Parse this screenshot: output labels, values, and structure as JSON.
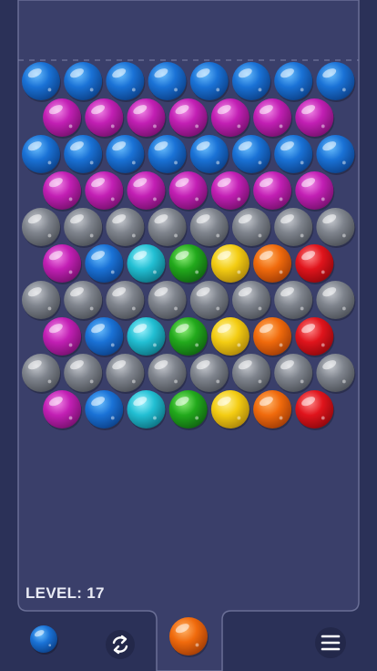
{
  "colors": {
    "background": "#2b3158",
    "board": "#3a3f6a",
    "board_edge": "#6a6f96",
    "text": "#e9ebf5"
  },
  "bubble_palette": {
    "B": {
      "name": "blue",
      "light": "#6cc0ff",
      "base": "#1a72d6",
      "dark": "#0b3f86"
    },
    "M": {
      "name": "magenta",
      "light": "#f28be8",
      "base": "#c21fb4",
      "dark": "#74106b"
    },
    "G": {
      "name": "gray",
      "light": "#c6c9cf",
      "base": "#7f848d",
      "dark": "#4a4e55"
    },
    "C": {
      "name": "cyan",
      "light": "#9ff4ff",
      "base": "#22bfd3",
      "dark": "#0c6f7e"
    },
    "N": {
      "name": "green",
      "light": "#8ff079",
      "base": "#22a91c",
      "dark": "#0f6010"
    },
    "Y": {
      "name": "yellow",
      "light": "#fff49a",
      "base": "#f3cc12",
      "dark": "#a8820a"
    },
    "O": {
      "name": "orange",
      "light": "#ffb56b",
      "base": "#f06a0c",
      "dark": "#9d3a06"
    },
    "R": {
      "name": "red",
      "light": "#ff8a8a",
      "base": "#e0141c",
      "dark": "#8c070c"
    }
  },
  "grid": [
    [
      "B",
      "B",
      "B",
      "B",
      "B",
      "B",
      "B",
      "B"
    ],
    [
      "M",
      "M",
      "M",
      "M",
      "M",
      "M",
      "M"
    ],
    [
      "B",
      "B",
      "B",
      "B",
      "B",
      "B",
      "B",
      "B"
    ],
    [
      "M",
      "M",
      "M",
      "M",
      "M",
      "M",
      "M"
    ],
    [
      "G",
      "G",
      "G",
      "G",
      "G",
      "G",
      "G",
      "G"
    ],
    [
      "M",
      "B",
      "C",
      "N",
      "Y",
      "O",
      "R"
    ],
    [
      "G",
      "G",
      "G",
      "G",
      "G",
      "G",
      "G",
      "G"
    ],
    [
      "M",
      "B",
      "C",
      "N",
      "Y",
      "O",
      "R"
    ],
    [
      "G",
      "G",
      "G",
      "G",
      "G",
      "G",
      "G",
      "G"
    ],
    [
      "M",
      "B",
      "C",
      "N",
      "Y",
      "O",
      "R"
    ]
  ],
  "status": {
    "level_label": "LEVEL:",
    "level_value": "17"
  },
  "shooter": {
    "current_color": "O",
    "next_color": "B"
  },
  "icons": {
    "swap": "refresh-icon",
    "menu": "hamburger-menu-icon"
  }
}
